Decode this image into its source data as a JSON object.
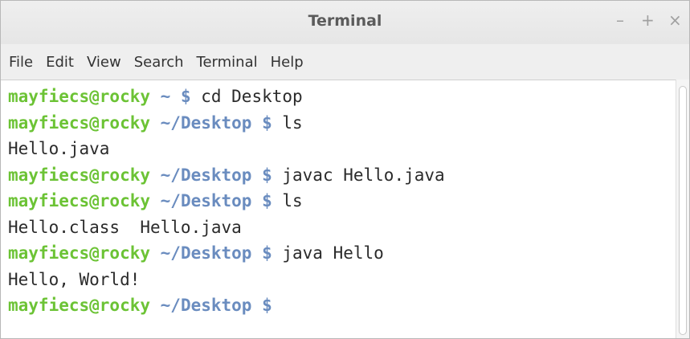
{
  "window": {
    "title": "Terminal",
    "controls": {
      "minimize": "–",
      "maximize": "+",
      "close": "×"
    }
  },
  "menubar": {
    "items": [
      "File",
      "Edit",
      "View",
      "Search",
      "Terminal",
      "Help"
    ]
  },
  "terminal": {
    "lines": [
      {
        "type": "prompt",
        "user": "mayfiecs@rocky",
        "path": " ~ $",
        "cmd": " cd Desktop"
      },
      {
        "type": "prompt",
        "user": "mayfiecs@rocky",
        "path": " ~/Desktop $",
        "cmd": " ls"
      },
      {
        "type": "output",
        "text": "Hello.java"
      },
      {
        "type": "prompt",
        "user": "mayfiecs@rocky",
        "path": " ~/Desktop $",
        "cmd": " javac Hello.java"
      },
      {
        "type": "prompt",
        "user": "mayfiecs@rocky",
        "path": " ~/Desktop $",
        "cmd": " ls"
      },
      {
        "type": "output",
        "text": "Hello.class  Hello.java"
      },
      {
        "type": "prompt",
        "user": "mayfiecs@rocky",
        "path": " ~/Desktop $",
        "cmd": " java Hello"
      },
      {
        "type": "output",
        "text": "Hello, World!"
      },
      {
        "type": "prompt",
        "user": "mayfiecs@rocky",
        "path": " ~/Desktop $",
        "cmd": ""
      }
    ]
  },
  "colors": {
    "user": "#6cc335",
    "path": "#6a8cbf",
    "text": "#2b2b2b",
    "background": "#ffffff"
  }
}
